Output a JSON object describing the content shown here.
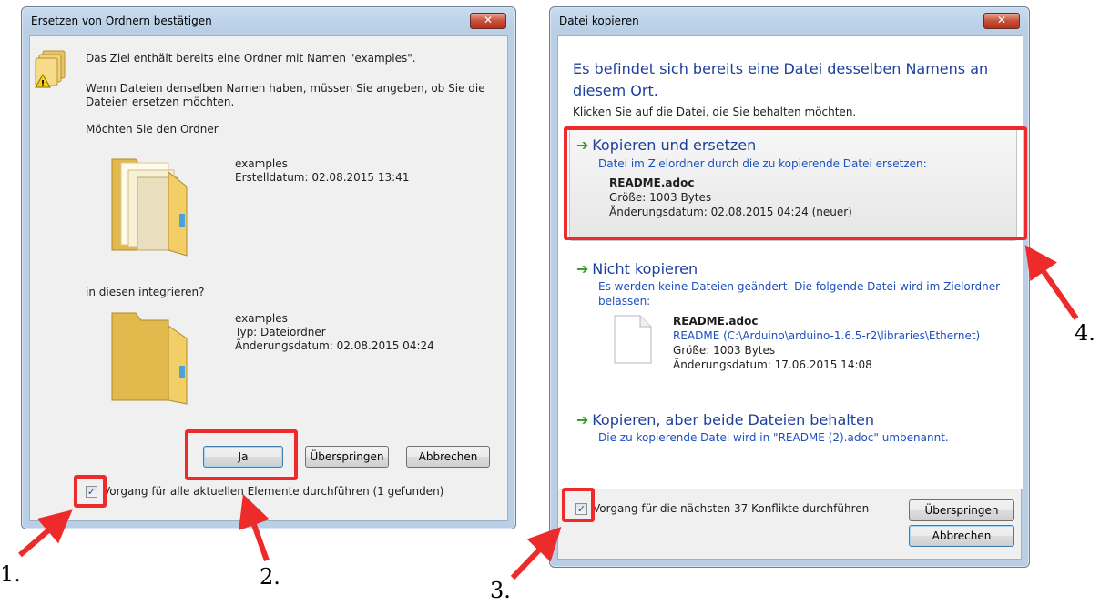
{
  "left_dialog": {
    "title": "Ersetzen von Ordnern bestätigen",
    "close_glyph": "✕",
    "warning_icon": "folder-warning-icon",
    "line1": "Das Ziel enthält bereits eine Ordner mit Namen \"examples\".",
    "line2a": "Wenn Dateien denselben Namen haben, müssen Sie angeben, ob Sie die",
    "line2b": "Dateien ersetzen möchten.",
    "question": "Möchten Sie den Ordner",
    "source": {
      "name": "examples",
      "created": "Erstelldatum: 02.08.2015 13:41",
      "icon": "folder-icon"
    },
    "merge_question": "in diesen integrieren?",
    "target": {
      "name": "examples",
      "type": "Typ: Dateiordner",
      "modified": "Änderungsdatum: 02.08.2015 04:24",
      "icon": "folder-icon"
    },
    "buttons": {
      "yes": "Ja",
      "skip": "Überspringen",
      "cancel": "Abbrechen"
    },
    "checkbox_label": "Vorgang für alle aktuellen Elemente durchführen (1 gefunden)",
    "checkbox_checked": true
  },
  "right_dialog": {
    "title": "Datei kopieren",
    "close_glyph": "✕",
    "header_a": "Es befindet sich bereits eine Datei desselben Namens an",
    "header_b": "diesem Ort.",
    "instruction": "Klicken Sie auf die Datei, die Sie behalten möchten.",
    "option_copy_replace": {
      "title": "Kopieren und ersetzen",
      "subtitle": "Datei im Zielordner durch die zu kopierende Datei ersetzen:",
      "file_name": "README.adoc",
      "size": "Größe: 1003 Bytes",
      "modified": "Änderungsdatum: 02.08.2015 04:24 (neuer)"
    },
    "option_no_copy": {
      "title": "Nicht kopieren",
      "subtitle_a": "Es werden keine Dateien geändert. Die folgende Datei wird im Zielordner",
      "subtitle_b": "belassen:",
      "file_name": "README.adoc",
      "path": "README (C:\\Arduino\\arduino-1.6.5-r2\\libraries\\Ethernet)",
      "size": "Größe: 1003 Bytes",
      "modified": "Änderungsdatum: 17.06.2015 14:08",
      "icon": "file-icon"
    },
    "option_keep_both": {
      "title": "Kopieren, aber beide Dateien behalten",
      "subtitle": "Die zu kopierende Datei wird in \"README (2).adoc\" umbenannt."
    },
    "arrow_glyph": "➔",
    "checkbox_label": "Vorgang für die nächsten 37 Konflikte durchführen",
    "checkbox_checked": true,
    "buttons": {
      "skip": "Überspringen",
      "cancel": "Abbrechen"
    }
  },
  "annotations": {
    "markers": [
      "1.",
      "2.",
      "3.",
      "4."
    ],
    "color": "#ee2b2b"
  }
}
